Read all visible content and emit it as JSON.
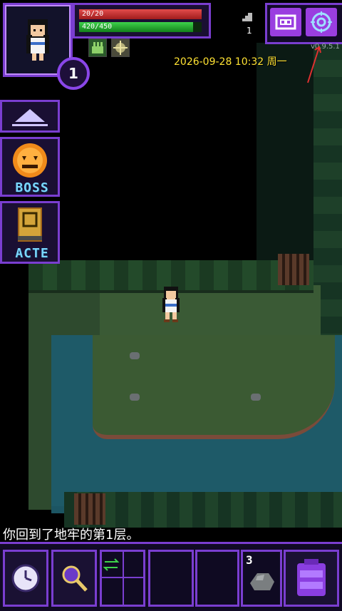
{
  "hud": {
    "hp_text": "20/20",
    "hp_fraction": 1.0,
    "exp_text": "420/450",
    "exp_fraction": 0.93,
    "level": "1",
    "depth": "1"
  },
  "overlay": {
    "timestamp": "2026-09-28 10:32 周一",
    "version": "v0.9.5.1"
  },
  "side_panel": {
    "boss_label": "BOSS",
    "acte_label": "ACTE"
  },
  "log": {
    "message": "你回到了地牢的第1层。"
  },
  "quickslot": {
    "stone_count": "3"
  },
  "icons": {
    "journal": "journal-icon",
    "settings": "settings-icon",
    "wait": "clock-icon",
    "search": "magnifier-icon",
    "swap": "swap-icon",
    "backpack": "backpack-icon",
    "stone": "throwing-stone-icon"
  },
  "colors": {
    "accent": "#7a3ed0",
    "timestamp": "#ffe233",
    "hp": "#e24b4b",
    "exp": "#3ed34b"
  }
}
